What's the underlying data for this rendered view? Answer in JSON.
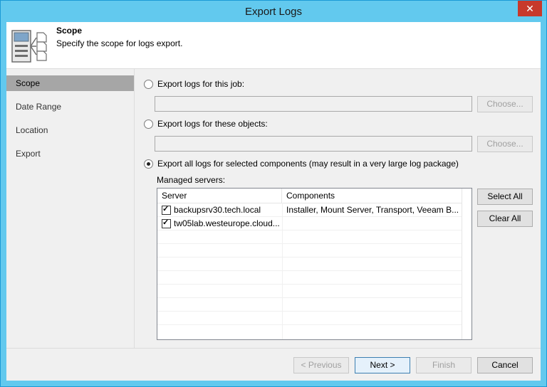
{
  "window": {
    "title": "Export Logs",
    "close_glyph": "✕"
  },
  "header": {
    "title": "Scope",
    "subtitle": "Specify the scope for logs export.",
    "icon": "export-logs-icon"
  },
  "nav": {
    "items": [
      {
        "label": "Scope",
        "active": true
      },
      {
        "label": "Date Range",
        "active": false
      },
      {
        "label": "Location",
        "active": false
      },
      {
        "label": "Export",
        "active": false
      }
    ]
  },
  "options": {
    "job": {
      "label": "Export logs for this job:",
      "checked": false,
      "value": "",
      "choose_label": "Choose..."
    },
    "objects": {
      "label": "Export logs for these objects:",
      "checked": false,
      "value": "",
      "choose_label": "Choose..."
    },
    "components": {
      "label": "Export all logs for selected components (may result in a very large log package)",
      "checked": true
    }
  },
  "managed": {
    "label": "Managed servers:",
    "columns": [
      "Server",
      "Components"
    ],
    "rows": [
      {
        "checked": true,
        "server": "backupsrv30.tech.local",
        "components": "Installer, Mount Server, Transport, Veeam B..."
      },
      {
        "checked": true,
        "server": "tw05lab.westeurope.cloud...",
        "components": ""
      }
    ],
    "select_all": "Select All",
    "clear_all": "Clear All"
  },
  "footer": {
    "previous": "< Previous",
    "next": "Next >",
    "finish": "Finish",
    "cancel": "Cancel"
  }
}
